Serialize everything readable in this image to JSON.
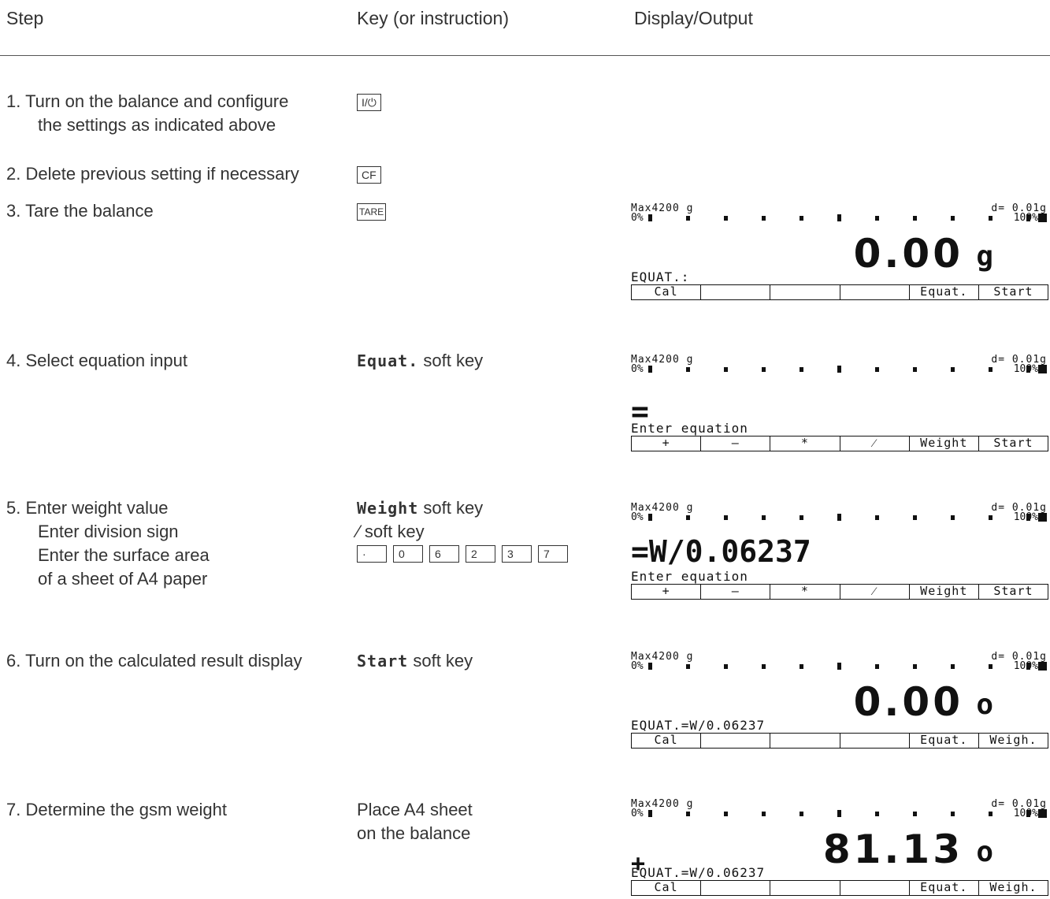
{
  "headers": {
    "step": "Step",
    "key": "Key (or instruction)",
    "display": "Display/Output"
  },
  "steps": [
    {
      "lines": [
        "1. Turn on the balance and configure",
        "the settings as indicated above"
      ],
      "key": "I/⏻"
    },
    {
      "lines": [
        "2. Delete previous setting if necessary"
      ],
      "key": "CF"
    },
    {
      "lines": [
        "3. Tare the balance"
      ],
      "key": "TARE"
    },
    {
      "lines": [
        "4. Select equation input"
      ],
      "key_bold": "Equat.",
      "key_text": "soft key"
    },
    {
      "lines": [
        "5. Enter weight value",
        "Enter division sign",
        "Enter the surface area",
        "of a sheet of A4 paper"
      ],
      "key_bold": "Weight",
      "key_text": "soft key",
      "key2_sym": "⁄",
      "key2_text": "soft key",
      "numkeys": [
        "·",
        "0",
        "6",
        "2",
        "3",
        "7"
      ]
    },
    {
      "lines": [
        "6. Turn on the calculated result display"
      ],
      "key_bold": "Start",
      "key_text": "soft key"
    },
    {
      "lines": [
        "7. Determine the gsm weight"
      ],
      "key_lines": [
        "Place A4 sheet",
        "on the balance"
      ]
    }
  ],
  "displays": [
    {
      "max": "Max4200 g",
      "d": "d= 0.01g",
      "zero": "0%",
      "hundred": "100%",
      "value": "0.00",
      "unit": "g",
      "status": "EQUAT.:",
      "softkeys": [
        "Cal",
        "",
        "",
        "",
        "Equat.",
        "Start"
      ]
    },
    {
      "max": "Max4200 g",
      "d": "d= 0.01g",
      "zero": "0%",
      "hundred": "100%",
      "big": "=",
      "status": "Enter equation",
      "softkeys": [
        "+",
        "–",
        "*",
        "⁄",
        "Weight",
        "Start"
      ]
    },
    {
      "max": "Max4200 g",
      "d": "d= 0.01g",
      "zero": "0%",
      "hundred": "100%",
      "big": "=W/0.06237",
      "status": "Enter equation",
      "softkeys": [
        "+",
        "–",
        "*",
        "⁄",
        "Weight",
        "Start"
      ]
    },
    {
      "max": "Max4200 g",
      "d": "d= 0.01g",
      "zero": "0%",
      "hundred": "100%",
      "value": "0.00",
      "unit": "o",
      "status": "EQUAT.=W/0.06237",
      "softkeys": [
        "Cal",
        "",
        "",
        "",
        "Equat.",
        "Weigh."
      ]
    },
    {
      "max": "Max4200 g",
      "d": "d= 0.01g",
      "zero": "0%",
      "hundred": "100%",
      "value": "81.13",
      "unit": "o",
      "sign": "+",
      "status": "EQUAT.=W/0.06237",
      "softkeys": [
        "Cal",
        "",
        "",
        "",
        "Equat.",
        "Weigh."
      ]
    }
  ]
}
